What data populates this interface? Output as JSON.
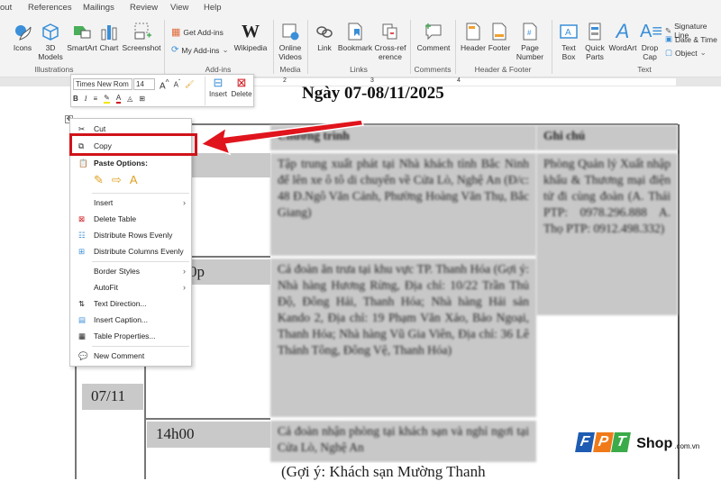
{
  "ribbon": {
    "tabs": [
      "out",
      "References",
      "Mailings",
      "Review",
      "View",
      "Help"
    ],
    "items": {
      "icons": "Icons",
      "models": "3D Models",
      "smartart": "SmartArt",
      "chart": "Chart",
      "screenshot": "Screenshot",
      "get_addins": "Get Add-ins",
      "my_addins": "My Add-ins",
      "wikipedia": "Wikipedia",
      "wikipedia_logo": "W",
      "online_videos": "Online Videos",
      "link": "Link",
      "bookmark": "Bookmark",
      "cross_reference": "Cross-reference",
      "comment": "Comment",
      "header": "Header",
      "footer": "Footer",
      "page_number": "Page Number",
      "text_box": "Text Box",
      "quick_parts": "Quick Parts",
      "wordart": "WordArt",
      "drop_cap": "Drop Cap",
      "signature_line": "Signature Line",
      "date_time": "Date & Time",
      "object": "Object"
    },
    "groups": {
      "illustrations": "Illustrations",
      "addins": "Add-ins",
      "media": "Media",
      "links": "Links",
      "comments": "Comments",
      "header_footer": "Header & Footer",
      "text": "Text"
    }
  },
  "ruler": {
    "marks": [
      "2",
      "3",
      "4"
    ]
  },
  "mini_toolbar": {
    "font": "Times New Rom",
    "size": "14",
    "bold": "B",
    "italic": "I",
    "insert": "Insert",
    "delete": "Delete",
    "colors": {
      "highlight": "#f5e600",
      "font": "#d0131a"
    }
  },
  "context_menu": {
    "cut": "Cut",
    "copy": "Copy",
    "paste_options": "Paste Options:",
    "insert": "Insert",
    "delete_table": "Delete Table",
    "distribute_rows": "Distribute Rows Evenly",
    "distribute_columns": "Distribute Columns Evenly",
    "border_styles": "Border Styles",
    "autofit": "AutoFit",
    "text_direction": "Text Direction...",
    "insert_caption": "Insert Caption...",
    "table_properties": "Table Properties...",
    "new_comment": "New Comment",
    "highlight_color": "#d0131a"
  },
  "document": {
    "title": "Ngày 07-08/11/2025",
    "headers": {
      "program": "Chương trình",
      "notes": "Ghi chú"
    },
    "time_cells": [
      "0",
      "0p",
      "14h00"
    ],
    "date": "07/11",
    "rows": [
      "Tập trung xuất phát tại Nhà khách tỉnh Bắc Ninh để lên xe ô tô di chuyển về Cửa Lò, Nghệ An (Đ/c: 48 Đ.Ngô Văn Cảnh, Phường Hoàng Văn Thụ, Bắc Giang)",
      "Cả đoàn ăn trưa tại khu vực TP. Thanh Hóa (Gợi ý: Nhà hàng Hương Rừng, Địa chỉ: 10/22 Trần Thủ Độ, Đông Hải, Thanh Hóa; Nhà hàng Hải sản Kando 2, Địa chỉ: 19 Phạm Văn Xảo, Bảo Ngoại, Thanh Hóa; Nhà hàng Vũ Gia Viên, Địa chỉ: 36 Lê Thánh Tông, Đông Vệ, Thanh Hóa)",
      "Cả đoàn nhận phòng tại khách sạn và nghỉ ngơi tại Cửa Lò, Nghệ An"
    ],
    "row3_extra": "(Gợi ý: Khách sạn Mường Thanh",
    "notes": "Phòng Quản lý Xuất nhập khẩu & Thương mại điện tử đi cùng đoàn (A. Thái PTP: 0978.296.888 A. Thọ PTP: 0912.498.332)"
  },
  "watermark": {
    "brand": "FPT",
    "shop": "Shop",
    ".com": ".com.vn",
    "colors": [
      "#1e5cb3",
      "#f07a1a",
      "#3bab49"
    ]
  }
}
